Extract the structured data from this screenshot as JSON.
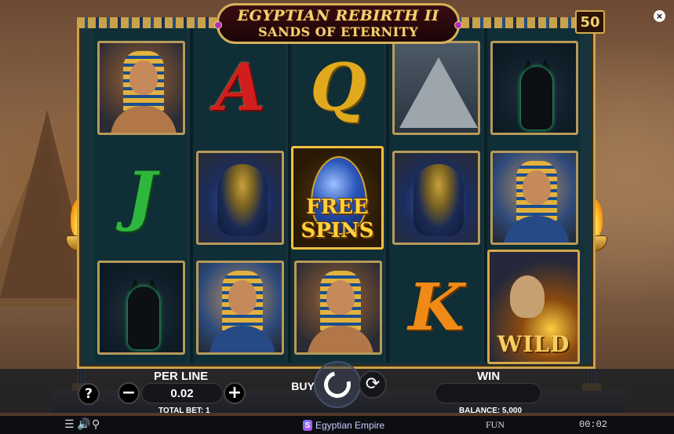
{
  "game": {
    "title_line1": "EGYPTIAN REBIRTH II",
    "title_line2": "SANDS OF ETERNITY",
    "lines_count": "50"
  },
  "reels": [
    [
      "cleopatra",
      "letter-j",
      "anubis-cat"
    ],
    [
      "letter-a",
      "cobra",
      "pharaoh"
    ],
    [
      "letter-q",
      "free-spins",
      "cleopatra"
    ],
    [
      "pyramid",
      "cobra",
      "letter-k"
    ],
    [
      "anubis-cat",
      "pharaoh",
      "wild"
    ]
  ],
  "symbols": {
    "letter_a": "A",
    "letter_q": "Q",
    "letter_j": "J",
    "letter_k": "K",
    "free_line1": "FREE",
    "free_line2": "SPINS",
    "wild": "WILD"
  },
  "controls": {
    "help_label": "?",
    "per_line_label": "PER LINE",
    "minus_label": "−",
    "plus_label": "+",
    "per_line_value": "0.02",
    "total_bet": "TOTAL BET: 1",
    "buy_label": "BUY",
    "win_label": "WIN",
    "win_value": "",
    "balance": "BALANCE: 5,000",
    "autoplay_icon": "⟳"
  },
  "footer": {
    "menu_icon": "☰",
    "sound_icon": "🔊",
    "turbo_icon": "⚲",
    "brand": "Egyptian Empire",
    "brand_mark": "S",
    "mode": "FUN",
    "clock": "00:02"
  },
  "colors": {
    "frame_gold": "#c9a24a",
    "reel_bg": "#0f2e36",
    "panel_bg": "#1c1e24"
  }
}
